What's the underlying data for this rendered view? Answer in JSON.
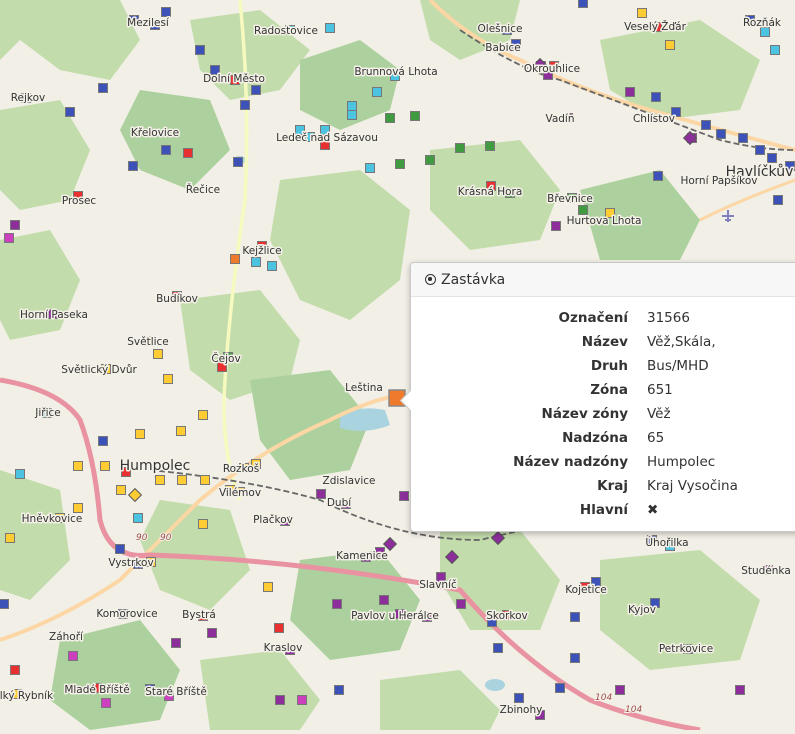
{
  "map": {
    "places": [
      {
        "name": "Mezilesí"
      },
      {
        "name": "Radostovice"
      },
      {
        "name": "Olešnice"
      },
      {
        "name": "Babice"
      },
      {
        "name": "Veselý Žďár"
      },
      {
        "name": "Rozňák"
      },
      {
        "name": "Dolní Město"
      },
      {
        "name": "Brunnová Lhota"
      },
      {
        "name": "Okrouhlice"
      },
      {
        "name": "Rejkov"
      },
      {
        "name": "Vadín"
      },
      {
        "name": "Chlístov"
      },
      {
        "name": "Křelovice"
      },
      {
        "name": "Ledeč nad Sázavou"
      },
      {
        "name": "Havlíčkův Brod"
      },
      {
        "name": "Řečice"
      },
      {
        "name": "Horní Papšíkov"
      },
      {
        "name": "Prosec"
      },
      {
        "name": "Krásná Hora"
      },
      {
        "name": "Břevnice"
      },
      {
        "name": "Hurtova Lhota"
      },
      {
        "name": "Kejžlice"
      },
      {
        "name": "Budíkov"
      },
      {
        "name": "Horní Paseka"
      },
      {
        "name": "Světlice"
      },
      {
        "name": "Světlický Dvůr"
      },
      {
        "name": "Čejov"
      },
      {
        "name": "Leština"
      },
      {
        "name": "Jiřice"
      },
      {
        "name": "Humpolec"
      },
      {
        "name": "Rozkoš"
      },
      {
        "name": "Zdislavice"
      },
      {
        "name": "Vilémov"
      },
      {
        "name": "Hněvkovice"
      },
      {
        "name": "Plačkov"
      },
      {
        "name": "Dubí"
      },
      {
        "name": "Kamenice"
      },
      {
        "name": "Úhořilka"
      },
      {
        "name": "Vystrkov"
      },
      {
        "name": "Studénka"
      },
      {
        "name": "Slavníč"
      },
      {
        "name": "Kojetice"
      },
      {
        "name": "Komorovice"
      },
      {
        "name": "Bystrá"
      },
      {
        "name": "Pavlov u Herálce"
      },
      {
        "name": "Skorkov"
      },
      {
        "name": "Kyjov"
      },
      {
        "name": "Záhoří"
      },
      {
        "name": "Kraslov"
      },
      {
        "name": "Petrkovice"
      },
      {
        "name": "Mladé Bříště"
      },
      {
        "name": "Staré Bříště"
      },
      {
        "name": "Zbinohy"
      },
      {
        "name": "Velký Rybník"
      }
    ],
    "road_labels": [
      "90",
      "90",
      "104",
      "104"
    ],
    "icons": [
      "airport-icon"
    ],
    "colors": {
      "background": "#f2efe6",
      "forest": "#c3dcab",
      "forest_dark": "#add19e",
      "water": "#a9d3de",
      "motorway": "#e892a2",
      "primary_road": "#fcd6a4",
      "secondary_road": "#f7fabf",
      "railway": "#666666",
      "stop_blue": "#3d52b8",
      "stop_cyan": "#4cc3e0",
      "stop_green": "#3f9a40",
      "stop_yellow": "#ffcc33",
      "stop_purple": "#8c2f9a",
      "stop_magenta": "#cc3fbf",
      "stop_red": "#e83030",
      "stop_orange": "#f07a2c"
    }
  },
  "popup": {
    "title": "Zastávka",
    "rows": [
      {
        "label": "Označení",
        "value": "31566"
      },
      {
        "label": "Název",
        "value": "Věž,Skála,"
      },
      {
        "label": "Druh",
        "value": "Bus/MHD"
      },
      {
        "label": "Zóna",
        "value": "651"
      },
      {
        "label": "Název zóny",
        "value": "Věž"
      },
      {
        "label": "Nadzóna",
        "value": "65"
      },
      {
        "label": "Název nadzóny",
        "value": "Humpolec"
      },
      {
        "label": "Kraj",
        "value": "Kraj Vysočina"
      },
      {
        "label": "Hlavní",
        "value": "✖"
      }
    ]
  }
}
